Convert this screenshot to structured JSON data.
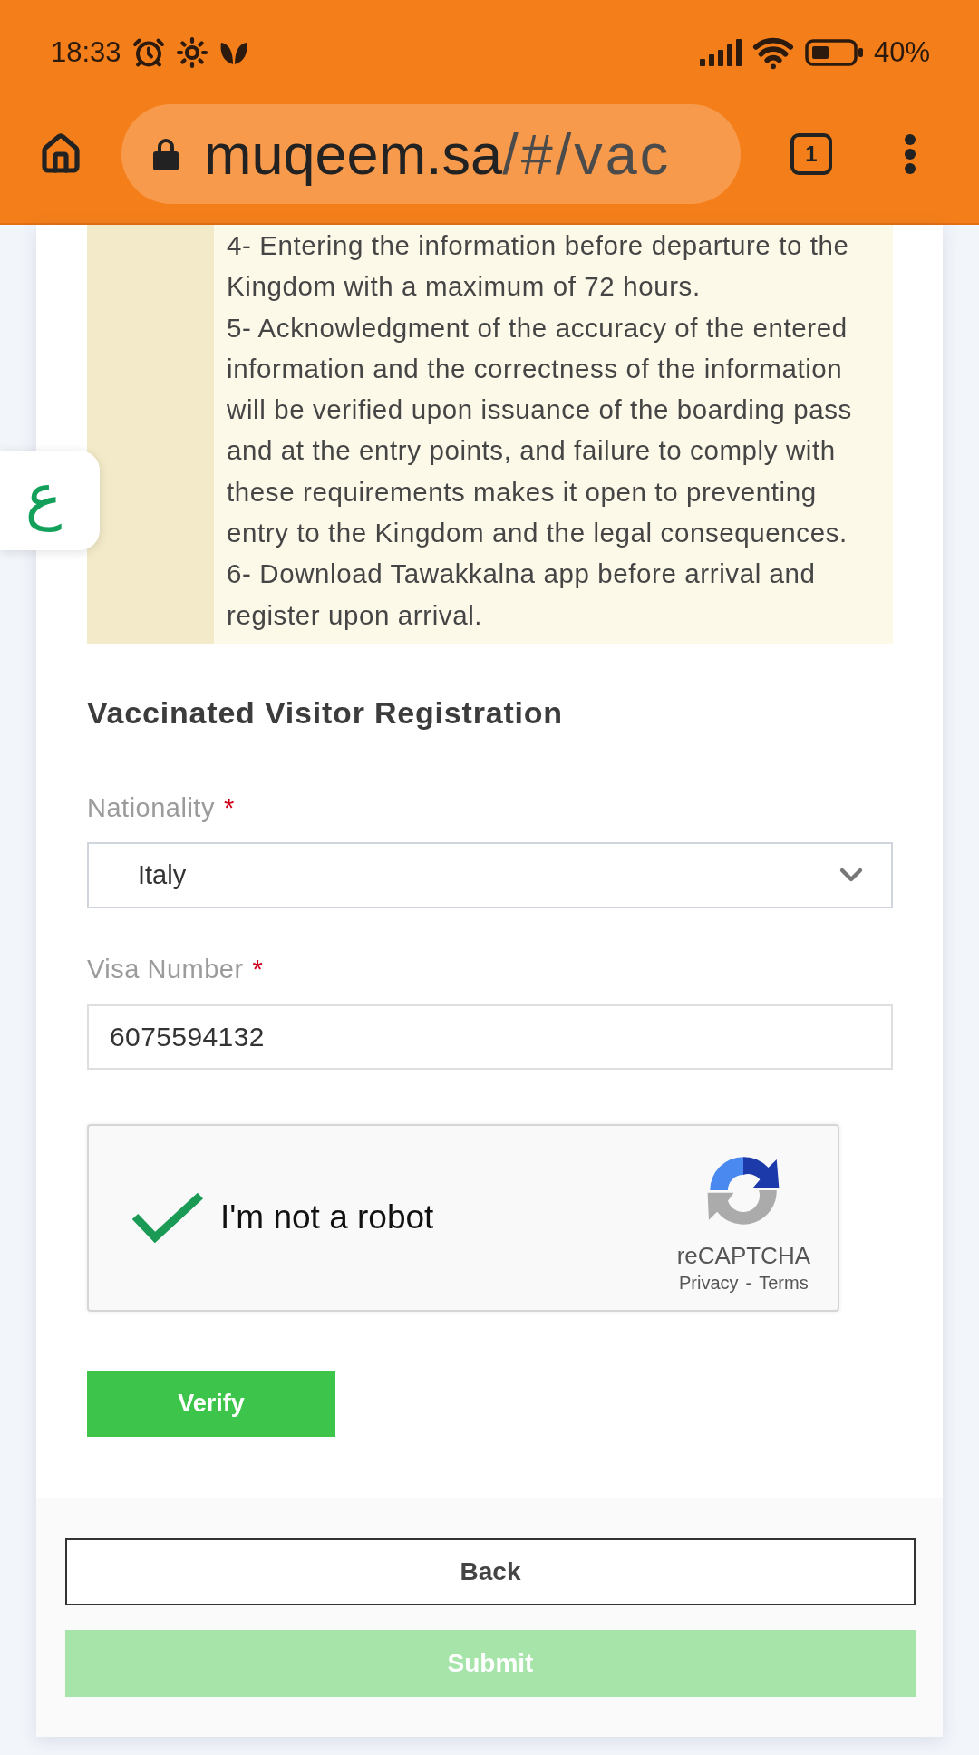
{
  "status_bar": {
    "time": "18:33",
    "battery": "40%"
  },
  "browser": {
    "url_host": "muqeem.sa",
    "url_path": "/#/vac",
    "tab_count": "1"
  },
  "language_button": {
    "label": "ع"
  },
  "notice": {
    "items": [
      "4- Entering the information before departure to the Kingdom with a maximum of 72 hours.",
      "5- Acknowledgment of the accuracy of the entered information and the correctness of the information will be verified upon issuance of the boarding pass and at the entry points, and failure to comply with these requirements makes it open to preventing entry to the Kingdom and the legal consequences.",
      "6- Download Tawakkalna app before arrival and register upon arrival."
    ]
  },
  "form": {
    "title": "Vaccinated Visitor Registration",
    "fields": [
      {
        "kind": "select",
        "label": "Nationality",
        "required_mark": "*",
        "value": "Italy"
      },
      {
        "kind": "text",
        "label": "Visa Number",
        "required_mark": "*",
        "value": "6075594132"
      }
    ],
    "captcha": {
      "label": "I'm not a robot",
      "checked": true,
      "brand": "reCAPTCHA",
      "links": [
        "Privacy",
        "Terms"
      ],
      "separator": "-"
    },
    "verify_button": "Verify"
  },
  "footer": {
    "buttons": [
      {
        "label": "Back",
        "kind": "outline",
        "disabled": false
      },
      {
        "label": "Submit",
        "kind": "filled",
        "disabled": true
      }
    ]
  }
}
